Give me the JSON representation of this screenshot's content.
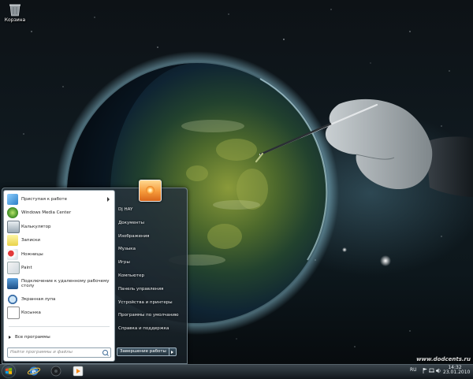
{
  "desktop": {
    "recycle_bin_label": "Корзина"
  },
  "watermark": "www.dodcents.ru",
  "start_menu": {
    "programs": [
      {
        "label": "Приступая к работе",
        "icon": "getting-started-icon",
        "has_submenu": true
      },
      {
        "label": "Windows Media Center",
        "icon": "media-center-icon",
        "has_submenu": false
      },
      {
        "label": "Калькулятор",
        "icon": "calculator-icon",
        "has_submenu": false
      },
      {
        "label": "Записки",
        "icon": "sticky-notes-icon",
        "has_submenu": false
      },
      {
        "label": "Ножницы",
        "icon": "snipping-tool-icon",
        "has_submenu": false
      },
      {
        "label": "Paint",
        "icon": "paint-icon",
        "has_submenu": false
      },
      {
        "label": "Подключение к удаленному рабочему столу",
        "icon": "remote-desktop-icon",
        "has_submenu": false
      },
      {
        "label": "Экранная лупа",
        "icon": "magnifier-icon",
        "has_submenu": false
      },
      {
        "label": "Косынка",
        "icon": "solitaire-icon",
        "has_submenu": false
      }
    ],
    "all_programs_label": "Все программы",
    "search_placeholder": "Найти программы и файлы",
    "right_items": [
      "Dj HAY",
      "Документы",
      "Изображения",
      "Музыка",
      "Игры",
      "Компьютер",
      "Панель управления",
      "Устройства и принтеры",
      "Программы по умолчанию",
      "Справка и поддержка"
    ],
    "shutdown_label": "Завершение работы"
  },
  "taskbar": {
    "pinned": [
      "internet-explorer-icon",
      "media-player-icon",
      "video-player-icon"
    ],
    "language": "RU",
    "time": "14:32",
    "date": "23.01.2010"
  }
}
